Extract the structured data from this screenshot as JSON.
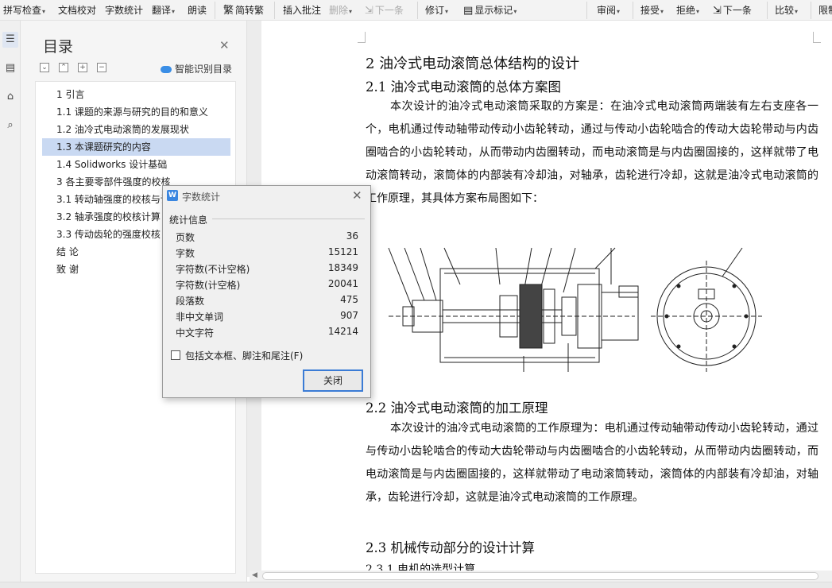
{
  "ribbon": {
    "spell_check": "拼写检查",
    "doc_proof": "文档校对",
    "word_count": "字数统计",
    "translate": "翻译",
    "read_aloud": "朗读",
    "simp_trad": "简转繁",
    "insert_comment": "插入批注",
    "delete": "删除",
    "next_comment": "下一条",
    "revise": "修订",
    "show_markup": "显示标记",
    "review": "审阅",
    "accept": "接受",
    "reject": "拒绝",
    "next_change": "下一条",
    "compare": "比较",
    "restrict": "限制"
  },
  "toc": {
    "title": "目录",
    "smart_toc": "智能识别目录",
    "items": [
      {
        "label": "1 引言"
      },
      {
        "label": "1.1  课题的来源与研究的目的和意义"
      },
      {
        "label": "1.2  油冷式电动滚筒的发展现状"
      },
      {
        "label": "1.3  本课题研究的内容"
      },
      {
        "label": "1.4 Solidworks 设计基础"
      },
      {
        "label": "3 各主要零部件强度的校核"
      },
      {
        "label": "3.1  转动轴强度的校核与计算"
      },
      {
        "label": "3.2  轴承强度的校核计算"
      },
      {
        "label": "3.3  传动齿轮的强度校核"
      },
      {
        "label": "结      论"
      },
      {
        "label": "致      谢"
      }
    ]
  },
  "document": {
    "h1": "2  油冷式电动滚筒总体结构的设计",
    "h2_1": "2.1  油冷式电动滚筒的总体方案图",
    "para1": "本次设计的油冷式电动滚筒采取的方案是：在油冷式电动滚筒两端装有左右支座各一个，电机通过传动轴带动传动小齿轮转动，通过与传动小齿轮啮合的传动大齿轮带动与内齿圈啮合的小齿轮转动，从而带动内齿圈转动，而电动滚筒是与内齿圈固接的，这样就带了电动滚筒转动，滚筒体的内部装有冷却油，对轴承，齿轮进行冷却，这就是油冷式电动滚筒的工作原理，其具体方案布局图如下：",
    "h2_2": "2.2  油冷式电动滚筒的加工原理",
    "para2": "本次设计的油冷式电动滚筒的工作原理为：电机通过传动轴带动传动小齿轮转动，通过与传动小齿轮啮合的传动大齿轮带动与内齿圈啮合的小齿轮转动，从而带动内齿圈转动，而电动滚筒是与内齿圈固接的，这样就带动了电动滚筒转动，滚筒体的内部装有冷却油，对轴承，齿轮进行冷却，这就是油冷式电动滚筒的工作原理。",
    "h2_3": "2.3  机械传动部分的设计计算",
    "h3_1": "2.3.1 电机的选型计算"
  },
  "dialog": {
    "title": "字数统计",
    "group": "统计信息",
    "stats": [
      {
        "label": "页数",
        "value": "36"
      },
      {
        "label": "字数",
        "value": "15121"
      },
      {
        "label": "字符数(不计空格)",
        "value": "18349"
      },
      {
        "label": "字符数(计空格)",
        "value": "20041"
      },
      {
        "label": "段落数",
        "value": "475"
      },
      {
        "label": "非中文单词",
        "value": "907"
      },
      {
        "label": "中文字符",
        "value": "14214"
      }
    ],
    "checkbox_label": "包括文本框、脚注和尾注(F)",
    "close": "关闭"
  },
  "colors": {
    "toc_selected": "#c9d9f2",
    "dialog_button_border": "#3a7bd5",
    "accent": "#3a8ee6"
  }
}
